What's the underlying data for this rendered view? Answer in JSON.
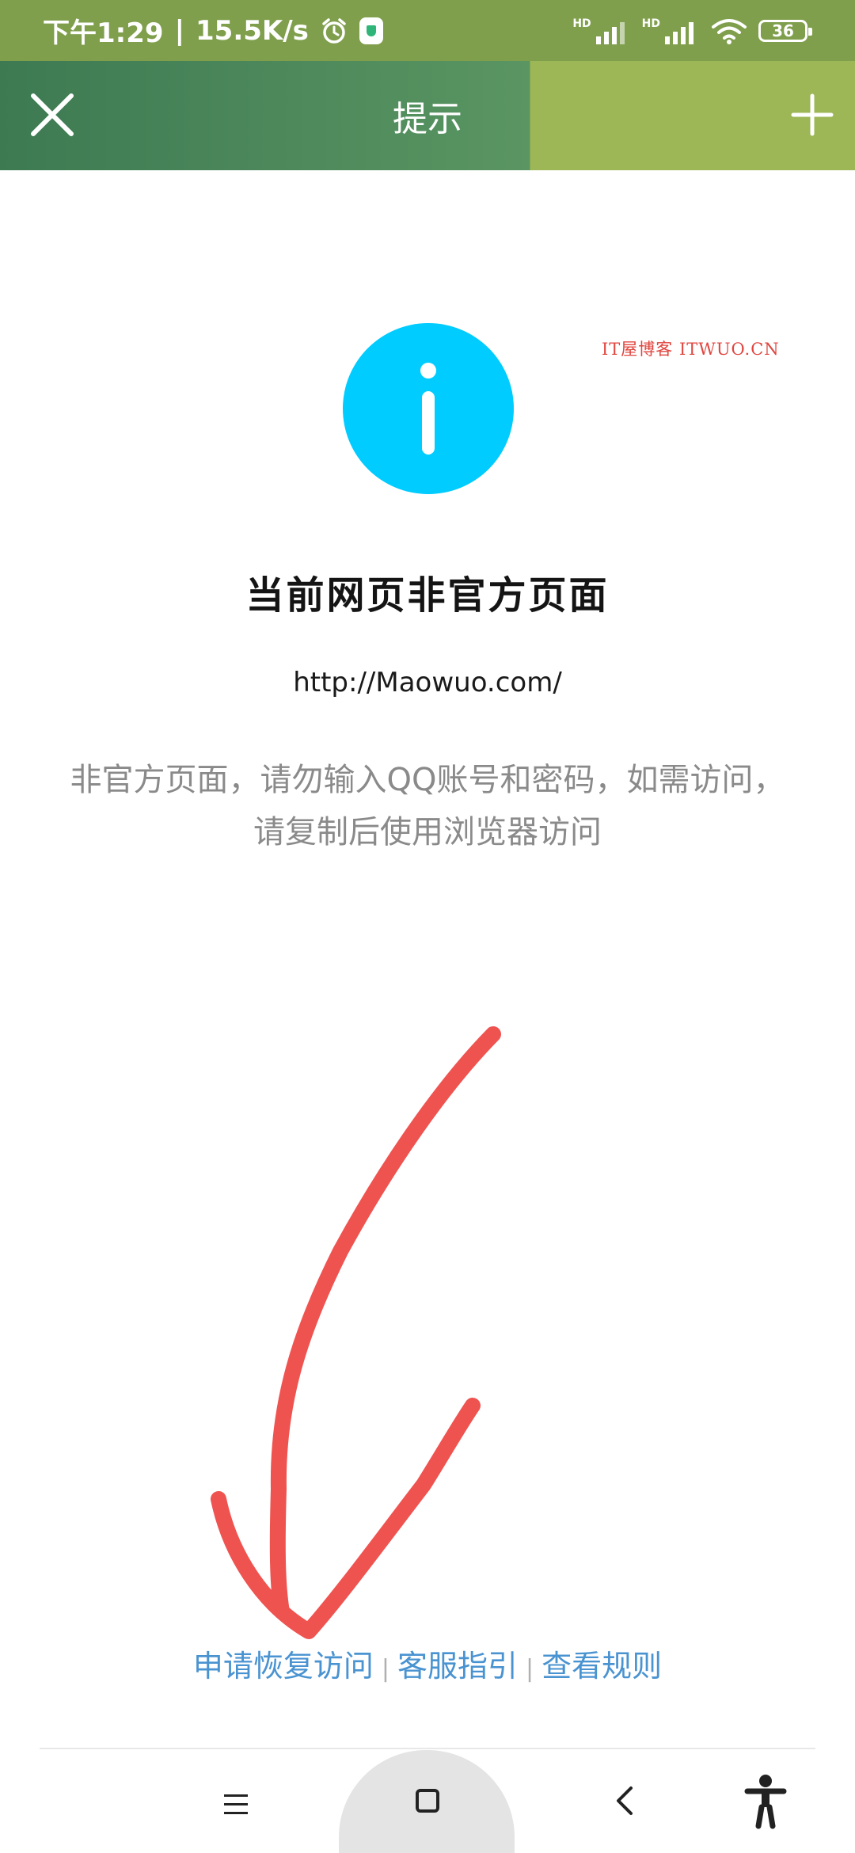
{
  "status_bar": {
    "time": "下午1:29",
    "separator": "|",
    "network_speed": "15.5K/s",
    "alarm_icon": "alarm-icon",
    "shield_icon": "shield-icon",
    "hd_label_1": "HD",
    "hd_label_2": "HD",
    "battery_level": "36"
  },
  "nav_bar": {
    "title": "提示",
    "close_icon": "close-icon",
    "add_icon": "plus-icon"
  },
  "watermark": "IT屋博客 ITWUO.CN",
  "content": {
    "info_icon": "info-icon",
    "title": "当前网页非官方页面",
    "url": "http://Maowuo.com/",
    "description_line1": "非官方页面，请勿输入QQ账号和密码，如需访问，",
    "description_line2": "请复制后使用浏览器访问"
  },
  "footer_links": {
    "restore_access": "申请恢复访问",
    "separator_1": "|",
    "customer_service": "客服指引",
    "separator_2": "|",
    "view_rules": "查看规则"
  },
  "annotation": {
    "arrow_color": "#ef5350"
  },
  "system_nav": {
    "menu_icon": "menu-icon",
    "home_icon": "home-icon",
    "back_icon": "back-icon",
    "accessibility_icon": "accessibility-icon"
  }
}
